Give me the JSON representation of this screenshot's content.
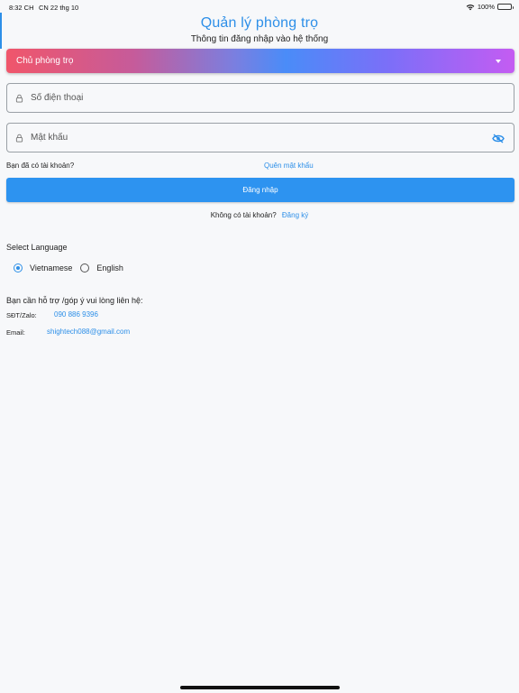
{
  "status_bar": {
    "time": "8:32 CH",
    "date": "CN 22 thg 10",
    "battery": "100%"
  },
  "header": {
    "title": "Quản lý phòng trọ",
    "subtitle": "Thông tin đăng nhập vào hệ thống"
  },
  "role_select": {
    "selected": "Chủ phòng trọ"
  },
  "phone_field": {
    "placeholder": "Số điện thoại",
    "value": ""
  },
  "password_field": {
    "placeholder": "Mật khẩu",
    "value": ""
  },
  "links": {
    "have_account": "Bạn đã có tài khoản?",
    "forgot_password": "Quên mật khẩu"
  },
  "login_button": {
    "label": "Đăng nhập"
  },
  "register": {
    "question": "Không có tài khoản?",
    "link": "Đăng ký"
  },
  "language": {
    "title": "Select Language",
    "options": [
      "Vietnamese",
      "English"
    ],
    "selected": "Vietnamese"
  },
  "support": {
    "heading": "Bạn cần hỗ trợ /góp ý vui lòng liên hệ:",
    "phone_label": "SĐT/Zalo:",
    "phone": "090 886 9396",
    "email_label": "Email:",
    "email": "shightech088@gmail.com"
  },
  "colors": {
    "accent": "#2d8fe8",
    "button": "#2d93f0",
    "gradient_start": "#f0566b",
    "gradient_end": "#c45cf2"
  }
}
